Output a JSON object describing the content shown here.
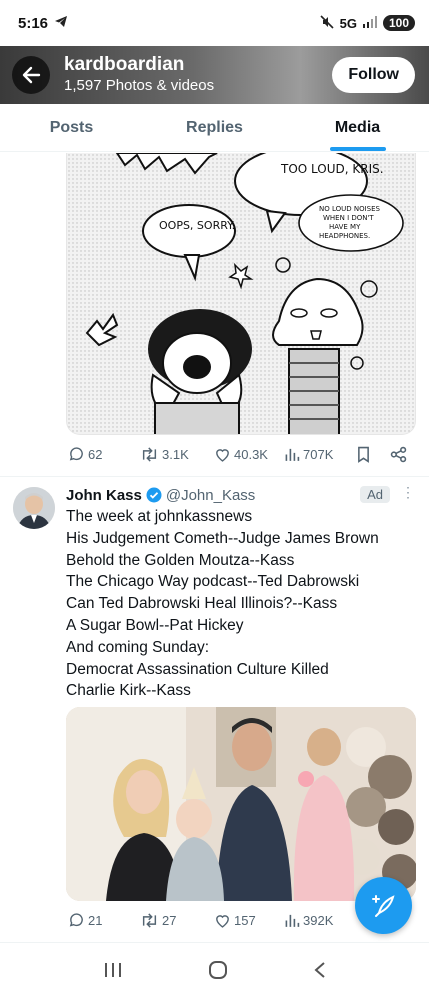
{
  "status_bar": {
    "time": "5:16",
    "network": "5G",
    "battery": "100"
  },
  "header": {
    "name": "kardboardian",
    "subtitle": "1,597 Photos & videos",
    "follow_label": "Follow"
  },
  "tabs": [
    {
      "label": "Posts"
    },
    {
      "label": "Replies"
    },
    {
      "label": "Media"
    }
  ],
  "comic": {
    "bubbles": [
      "TOO LOUD, KRIS.",
      "OOPS, SORRY.",
      "NO LOUD NOISES WHEN I DON'T HAVE MY HEADPHONES."
    ]
  },
  "first_post_actions": {
    "replies": "62",
    "reposts": "3.1K",
    "likes": "40.3K",
    "views": "707K"
  },
  "ad_post": {
    "author": "John Kass",
    "handle": "@John_Kass",
    "badge": "Ad",
    "lines": [
      "The week at johnkassnews",
      "His Judgement Cometh--Judge James Brown",
      "Behold the Golden Moutza--Kass",
      "The Chicago Way podcast--Ted Dabrowski",
      "Can Ted Dabrowski Heal Illinois?--Kass",
      "A Sugar Bowl--Pat Hickey",
      "And coming Sunday:",
      "Democrat Assassination Culture Killed",
      "Charlie Kirk--Kass"
    ],
    "actions": {
      "replies": "21",
      "reposts": "27",
      "likes": "157",
      "views": "392K"
    }
  },
  "colors": {
    "accent": "#1d9bf0",
    "muted": "#536471",
    "text": "#0f1419"
  }
}
